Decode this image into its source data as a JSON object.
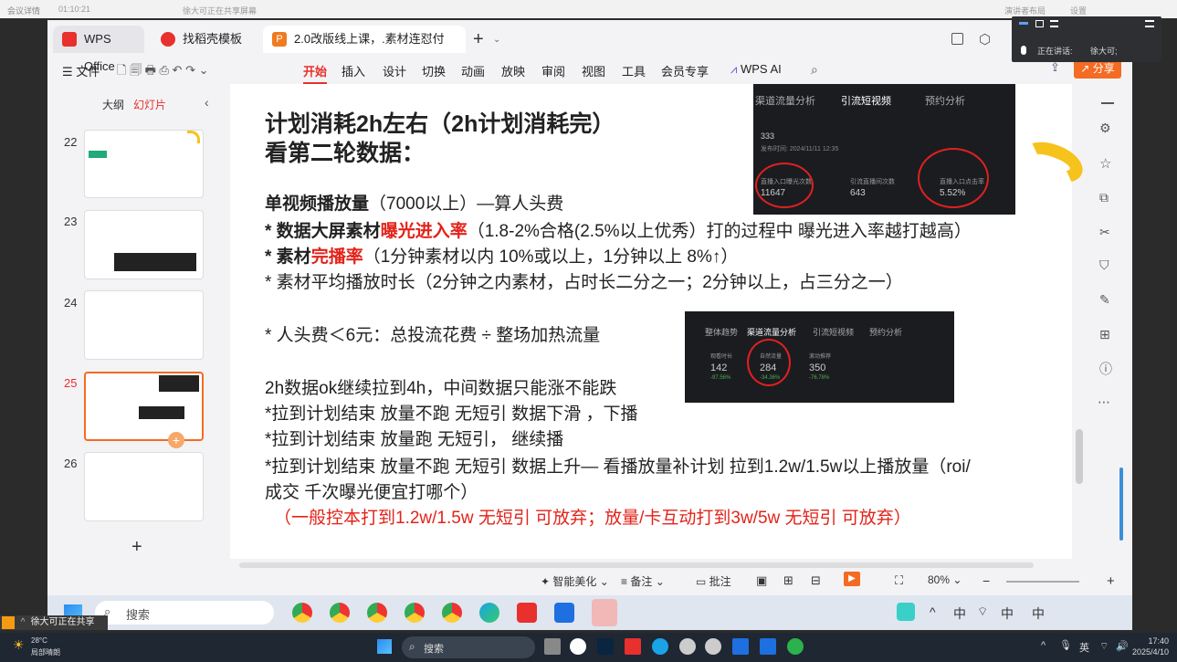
{
  "meeting": {
    "app": "会议详情",
    "time": "01:10:21",
    "sharing": "徐大可正在共享屏幕",
    "btn1": "演讲者布局",
    "btn2": "设置"
  },
  "float_panel": {
    "speaking_label": "正在讲话:",
    "speaker": "徐大可;"
  },
  "tabs": [
    {
      "label": "WPS Office"
    },
    {
      "label": "找稻壳模板"
    },
    {
      "label": "2.0改版线上课，.素材连怼付"
    }
  ],
  "menu": {
    "file": "文件",
    "items": [
      "开始",
      "插入",
      "设计",
      "切换",
      "动画",
      "放映",
      "审阅",
      "视图",
      "工具",
      "会员专享"
    ],
    "ai": "WPS AI",
    "share": "分享"
  },
  "panel": {
    "outline": "大纲",
    "slides": "幻灯片"
  },
  "thumbs": [
    {
      "num": "22"
    },
    {
      "num": "23"
    },
    {
      "num": "24"
    },
    {
      "num": "25"
    },
    {
      "num": "26"
    }
  ],
  "slide": {
    "title1": "计划消耗2h左右（2h计划消耗完）",
    "title2": "看第二轮数据：",
    "l1a": "单视频播放量",
    "l1b": "（7000以上）—算人头费",
    "l2a": "* 数据大屏素材",
    "l2b": "曝光进入率",
    "l2c": "（1.8-2%合格(2.5%以上优秀）打的过程中 曝光进入率越打越高）",
    "l3a": "* 素材",
    "l3b": "完播率",
    "l3c": "（1分钟素材以内 10%或以上，1分钟以上 8%↑）",
    "l4": "* 素材平均播放时长（2分钟之内素材，占时长二分之一；2分钟以上，占三分之一）",
    "l5a": "* 人头费＜6元：总投流花费",
    "l5b": "整场加热流量",
    "l6": "2h数据ok继续拉到4h，中间数据只能涨不能跌",
    "l7": "*拉到计划结束 放量不跑 无短引 数据下滑 ，下播",
    "l8": "*拉到计划结束  放量跑 无短引，  继续播",
    "l9": "*拉到计划结束 放量不跑 无短引 数据上升— 看播放量补计划 拉到1.2w/1.5w以上播放量（roi/",
    "l10": "成交 千次曝光便宜打哪个）",
    "l11": "（一般控本打到1.2w/1.5w 无短引 可放弃；放量/卡互动打到3w/5w 无短引 可放弃）",
    "ss1": {
      "tabs": [
        "渠道流量分析",
        "引流短视频",
        "预约分析"
      ],
      "num": "333",
      "time": "发布时间: 2024/11/11 12:35",
      "m1l": "直播入口曝光次数",
      "m1v": "11647",
      "m2l": "引流直播间次数",
      "m2v": "643",
      "m3l": "直播入口点击率",
      "m3v": "5.52%"
    },
    "ss2": {
      "tabs": [
        "整体趋势",
        "渠道流量分析",
        "引流短视频",
        "预约分析"
      ],
      "m1l": "观看时长",
      "m1v": "142",
      "m1d": "-97.56%",
      "m2l": "自然流量",
      "m2v": "284",
      "m2d": "-34.36%",
      "m3l": "滚动推荐",
      "m3v": "350",
      "m3d": "-76.78%"
    }
  },
  "status": {
    "beautify": "智能美化",
    "notes": "备注",
    "comment": "批注",
    "zoom": "80%"
  },
  "rtask": {
    "search": "搜索",
    "ime1": "中",
    "ime2": "中",
    "ime3": "中"
  },
  "share_note": "徐大可正在共享",
  "wtask": {
    "temp": "28°C",
    "weather": "局部晴朗",
    "search": "搜索",
    "lang": "英",
    "time": "17:40",
    "date": "2025/4/10"
  }
}
